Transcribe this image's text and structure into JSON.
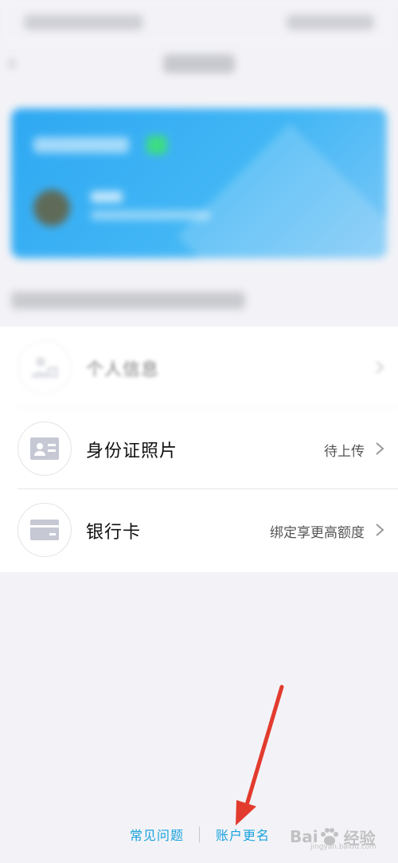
{
  "list": {
    "items": [
      {
        "label": "个人信息",
        "status": "",
        "icon": "person-id-icon"
      },
      {
        "label": "身份证照片",
        "status": "待上传",
        "icon": "id-card-icon"
      },
      {
        "label": "银行卡",
        "status": "绑定享更高额度",
        "icon": "bank-card-icon"
      }
    ]
  },
  "footer": {
    "faq_label": "常见问题",
    "rename_label": "账户更名"
  },
  "watermark": {
    "text": "Bai",
    "suffix": "经验",
    "sub": "jingyan.baidu.com"
  },
  "colors": {
    "accent": "#1aa3dd",
    "hero_blue": "#2ea8f2",
    "annotation_red": "#e23b2e"
  }
}
